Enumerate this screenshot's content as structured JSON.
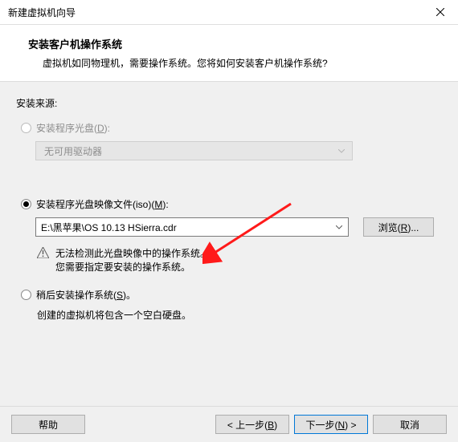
{
  "window": {
    "title": "新建虚拟机向导"
  },
  "header": {
    "title": "安装客户机操作系统",
    "subtitle": "虚拟机如同物理机，需要操作系统。您将如何安装客户机操作系统?"
  },
  "source": {
    "label": "安装来源:"
  },
  "opt_disc": {
    "prefix": "安装程序光盘(",
    "mnemonic": "D",
    "suffix": "):",
    "dropdown_text": "无可用驱动器"
  },
  "opt_iso": {
    "prefix": "安装程序光盘映像文件(iso)(",
    "mnemonic": "M",
    "suffix": "):",
    "combo_value": "E:\\黑苹果\\OS 10.13 HSierra.cdr",
    "browse_prefix": "浏览(",
    "browse_mnemonic": "R",
    "browse_suffix": ")...",
    "warn_line1": "无法检测此光盘映像中的操作系统。",
    "warn_line2": "您需要指定要安装的操作系统。"
  },
  "opt_later": {
    "prefix": "稍后安装操作系统(",
    "mnemonic": "S",
    "suffix": ")。",
    "hint": "创建的虚拟机将包含一个空白硬盘。"
  },
  "footer": {
    "help": "帮助",
    "back_prefix": "< 上一步(",
    "back_mnemonic": "B",
    "back_suffix": ")",
    "next_prefix": "下一步(",
    "next_mnemonic": "N",
    "next_suffix": ") >",
    "cancel": "取消"
  }
}
